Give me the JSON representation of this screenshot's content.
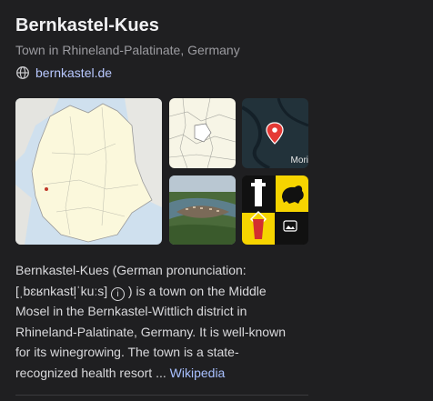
{
  "header": {
    "title": "Bernkastel-Kues",
    "subtitle": "Town in Rhineland-Palatinate, Germany",
    "website": "bernkastel.de"
  },
  "icons": {
    "website": "globe-icon",
    "map_pin": "map-pin-icon",
    "gallery": "image-icon"
  },
  "images": {
    "map_label": "Mori"
  },
  "description": {
    "text_before_icon": "Bernkastel-Kues (German pronunciation: [ˌbɛʁnkastl̩ˈkuːs]",
    "info_glyph": "i",
    "text_after_icon": ") is a town on the Middle Mosel in the Bernkastel-Wittlich district in Rhineland-Palatinate, Germany. It is well-known for its winegrowing. The town is a state-recognized health resort ...",
    "source_link": "Wikipedia"
  },
  "colors": {
    "background": "#1f1f21",
    "link": "#b8c8ff",
    "pin": "#e53935",
    "coat_yellow": "#f6d400"
  }
}
